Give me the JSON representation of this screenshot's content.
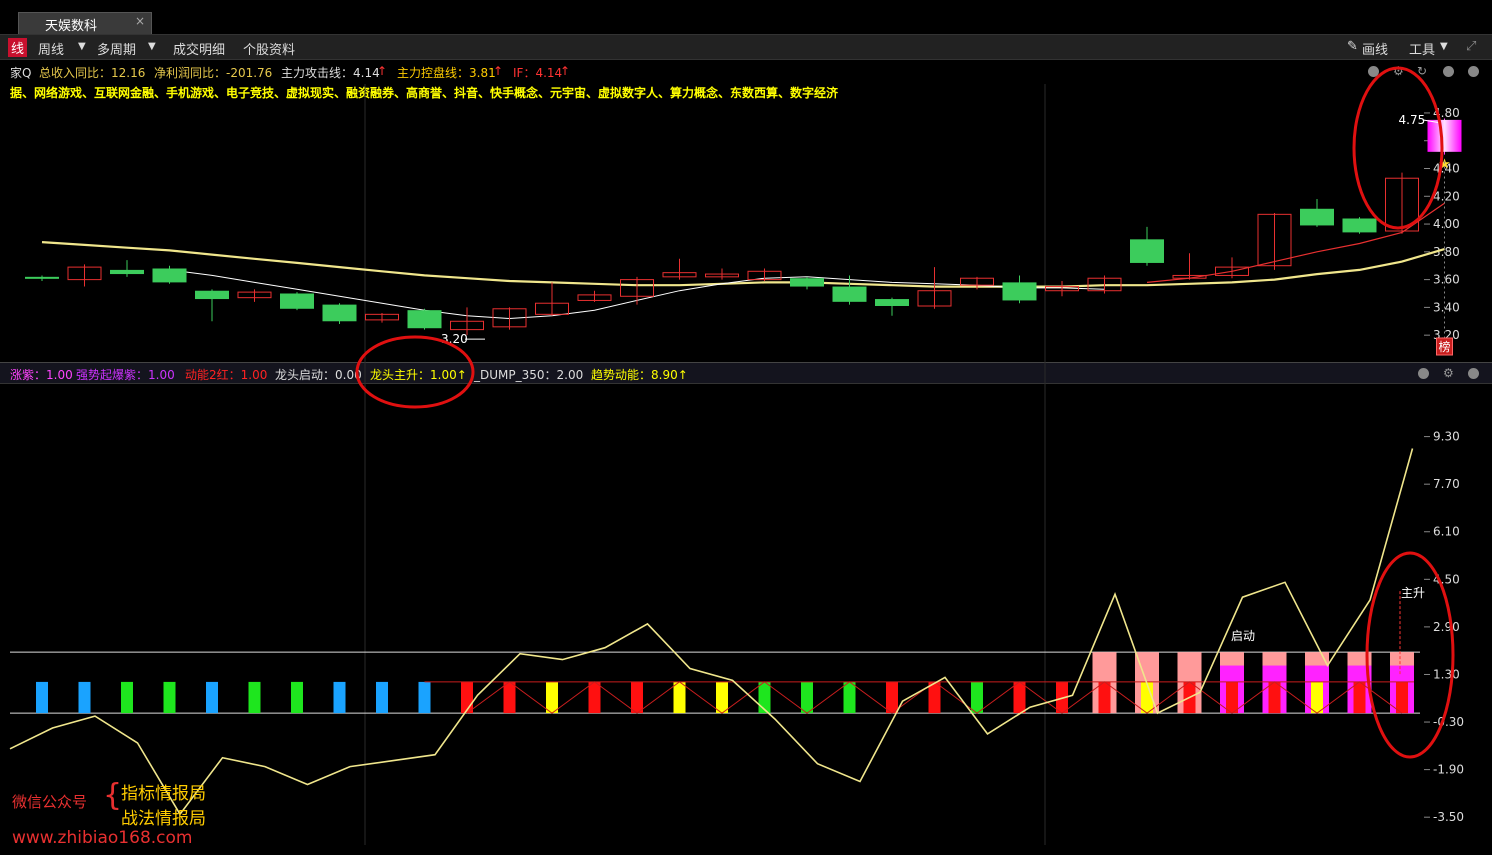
{
  "window": {
    "tab_title": "天娱数科",
    "close_glyph": "×"
  },
  "toolbar": {
    "items": [
      "线",
      "周线",
      "多周期",
      "成交明细",
      "个股资料"
    ],
    "draw_label": "画线",
    "tools_label": "工具"
  },
  "info": {
    "prefix": "家Q",
    "revenue": "总收入同比：12.16",
    "profit": "净利润同比：-201.76",
    "attack": "主力攻击线：4.14",
    "control": "主力控盘线：3.81",
    "if": "IF：4.14",
    "arrow": "↑"
  },
  "concepts": "据、网络游戏、互联网金融、手机游戏、电子竞技、虚拟现实、融资融券、高商誉、抖音、快手概念、元宇宙、虚拟数字人、算力概念、东数西算、数字经济",
  "indicator_bar": {
    "items": [
      {
        "text": "涨紫：1.00",
        "color": "#ff44ff"
      },
      {
        "text": "强势起爆紫：1.00",
        "color": "#cc33ff"
      },
      {
        "text": "动能2红：1.00",
        "color": "#ff2222"
      },
      {
        "text": "龙头启动：0.00",
        "color": "#dddddd"
      },
      {
        "text": "龙头主升：1.00↑",
        "color": "#ffff00"
      },
      {
        "text": "_DUMP_350：2.00",
        "color": "#dddddd"
      },
      {
        "text": "趋势动能：8.90↑",
        "color": "#ffff00"
      }
    ]
  },
  "watermark": {
    "label": "微信公众号",
    "line1": "指标情报局",
    "line2": "战法情报局",
    "url": "www.zhibiao168.com"
  },
  "colors": {
    "up": "#e83030",
    "down": "#3ccc5c",
    "ma_long": "#f0e68c",
    "ma_short": "#ffffff",
    "ma_red": "#e83030",
    "highlight": "#ff44ff",
    "circle": "#e01010"
  },
  "chart_data": [
    {
      "type": "candlestick",
      "period": "weekly",
      "y_ticks": [
        "4.80",
        "4.60",
        "4.40",
        "4.20",
        "4.00",
        "3.80",
        "3.60",
        "3.40",
        "3.20"
      ],
      "ylim": [
        3.05,
        4.85
      ],
      "annotations": {
        "low_label": "3.20",
        "high_label": "4.75",
        "rank_badge": "榜"
      },
      "candles": [
        {
          "o": 3.62,
          "c": 3.61,
          "h": 3.63,
          "l": 3.59
        },
        {
          "o": 3.6,
          "c": 3.69,
          "h": 3.71,
          "l": 3.55
        },
        {
          "o": 3.67,
          "c": 3.64,
          "h": 3.74,
          "l": 3.62
        },
        {
          "o": 3.68,
          "c": 3.58,
          "h": 3.7,
          "l": 3.57
        },
        {
          "o": 3.52,
          "c": 3.46,
          "h": 3.53,
          "l": 3.3
        },
        {
          "o": 3.47,
          "c": 3.51,
          "h": 3.53,
          "l": 3.44
        },
        {
          "o": 3.5,
          "c": 3.39,
          "h": 3.51,
          "l": 3.38
        },
        {
          "o": 3.42,
          "c": 3.3,
          "h": 3.43,
          "l": 3.28
        },
        {
          "o": 3.31,
          "c": 3.35,
          "h": 3.36,
          "l": 3.29
        },
        {
          "o": 3.38,
          "c": 3.25,
          "h": 3.39,
          "l": 3.24
        },
        {
          "o": 3.24,
          "c": 3.3,
          "h": 3.4,
          "l": 3.2
        },
        {
          "o": 3.26,
          "c": 3.39,
          "h": 3.4,
          "l": 3.24
        },
        {
          "o": 3.35,
          "c": 3.43,
          "h": 3.58,
          "l": 3.34
        },
        {
          "o": 3.45,
          "c": 3.49,
          "h": 3.52,
          "l": 3.44
        },
        {
          "o": 3.48,
          "c": 3.6,
          "h": 3.62,
          "l": 3.42
        },
        {
          "o": 3.62,
          "c": 3.65,
          "h": 3.75,
          "l": 3.6
        },
        {
          "o": 3.62,
          "c": 3.64,
          "h": 3.68,
          "l": 3.6
        },
        {
          "o": 3.6,
          "c": 3.66,
          "h": 3.68,
          "l": 3.59
        },
        {
          "o": 3.61,
          "c": 3.55,
          "h": 3.62,
          "l": 3.53
        },
        {
          "o": 3.55,
          "c": 3.44,
          "h": 3.63,
          "l": 3.42
        },
        {
          "o": 3.46,
          "c": 3.41,
          "h": 3.47,
          "l": 3.34
        },
        {
          "o": 3.41,
          "c": 3.52,
          "h": 3.69,
          "l": 3.39
        },
        {
          "o": 3.56,
          "c": 3.61,
          "h": 3.62,
          "l": 3.53
        },
        {
          "o": 3.58,
          "c": 3.45,
          "h": 3.63,
          "l": 3.43
        },
        {
          "o": 3.52,
          "c": 3.55,
          "h": 3.59,
          "l": 3.48
        },
        {
          "o": 3.52,
          "c": 3.61,
          "h": 3.63,
          "l": 3.5
        },
        {
          "o": 3.89,
          "c": 3.72,
          "h": 3.98,
          "l": 3.7
        },
        {
          "o": 3.61,
          "c": 3.63,
          "h": 3.79,
          "l": 3.6
        },
        {
          "o": 3.63,
          "c": 3.69,
          "h": 3.76,
          "l": 3.61
        },
        {
          "o": 3.7,
          "c": 4.07,
          "h": 4.08,
          "l": 3.67
        },
        {
          "o": 4.11,
          "c": 3.99,
          "h": 4.18,
          "l": 3.98
        },
        {
          "o": 4.04,
          "c": 3.94,
          "h": 4.05,
          "l": 3.93
        },
        {
          "o": 3.95,
          "c": 4.33,
          "h": 4.37,
          "l": 3.93
        },
        {
          "o": 4.52,
          "c": 4.75,
          "h": 4.76,
          "l": 4.5,
          "hl": true
        }
      ],
      "ma_long": [
        3.87,
        3.85,
        3.83,
        3.81,
        3.78,
        3.75,
        3.72,
        3.69,
        3.66,
        3.63,
        3.61,
        3.59,
        3.58,
        3.57,
        3.56,
        3.56,
        3.57,
        3.58,
        3.58,
        3.57,
        3.56,
        3.55,
        3.55,
        3.55,
        3.55,
        3.56,
        3.56,
        3.57,
        3.58,
        3.6,
        3.64,
        3.67,
        3.73,
        3.82
      ],
      "ma_short": [
        null,
        null,
        null,
        3.67,
        3.63,
        3.58,
        3.53,
        3.48,
        3.43,
        3.38,
        3.34,
        3.32,
        3.34,
        3.38,
        3.45,
        3.52,
        3.57,
        3.61,
        3.62,
        3.6,
        3.58,
        3.57,
        3.56,
        3.54,
        3.54,
        3.53
      ],
      "ma_red": {
        "start": 26,
        "values": [
          3.58,
          3.61,
          3.66,
          3.73,
          3.8,
          3.86,
          3.94,
          4.15
        ]
      }
    },
    {
      "type": "bar+line",
      "y_ticks": [
        "9.30",
        "7.70",
        "6.10",
        "4.50",
        "2.90",
        "1.30",
        "-0.30",
        "-1.90",
        "-3.50"
      ],
      "ylim": [
        -4.2,
        10.8
      ],
      "h_lines": [
        2.05,
        0.0
      ],
      "labels": {
        "start": "启动",
        "rise": "主升"
      },
      "line": [
        -1.2,
        -0.5,
        -0.1,
        -1.0,
        -3.4,
        -1.5,
        -1.8,
        -2.4,
        -1.8,
        -1.6,
        -1.4,
        0.6,
        2.0,
        1.8,
        2.2,
        3.0,
        1.5,
        1.1,
        -0.2,
        -1.7,
        -2.3,
        0.4,
        1.2,
        -0.7,
        0.2,
        0.6,
        4.0,
        0.0,
        0.7,
        3.9,
        4.4,
        1.6,
        3.8,
        8.9
      ],
      "bars": [
        {
          "type": "blue"
        },
        {
          "type": "blue"
        },
        {
          "type": "green"
        },
        {
          "type": "green"
        },
        {
          "type": "blue"
        },
        {
          "type": "green"
        },
        {
          "type": "green"
        },
        {
          "type": "blue"
        },
        {
          "type": "blue"
        },
        {
          "type": "blue"
        },
        {
          "type": "red"
        },
        {
          "type": "red"
        },
        {
          "type": "yellow"
        },
        {
          "type": "red"
        },
        {
          "type": "red"
        },
        {
          "type": "yellow"
        },
        {
          "type": "yellow"
        },
        {
          "type": "green"
        },
        {
          "type": "green"
        },
        {
          "type": "green"
        },
        {
          "type": "red"
        },
        {
          "type": "red"
        },
        {
          "type": "green"
        },
        {
          "type": "red"
        },
        {
          "type": "red"
        },
        {
          "type": "pink_red"
        },
        {
          "type": "pink_yellow"
        },
        {
          "type": "pink_red"
        },
        {
          "type": "pm_red"
        },
        {
          "type": "pm_red"
        },
        {
          "type": "pm_yellow"
        },
        {
          "type": "pm_red"
        },
        {
          "type": "pm_red"
        }
      ]
    }
  ]
}
